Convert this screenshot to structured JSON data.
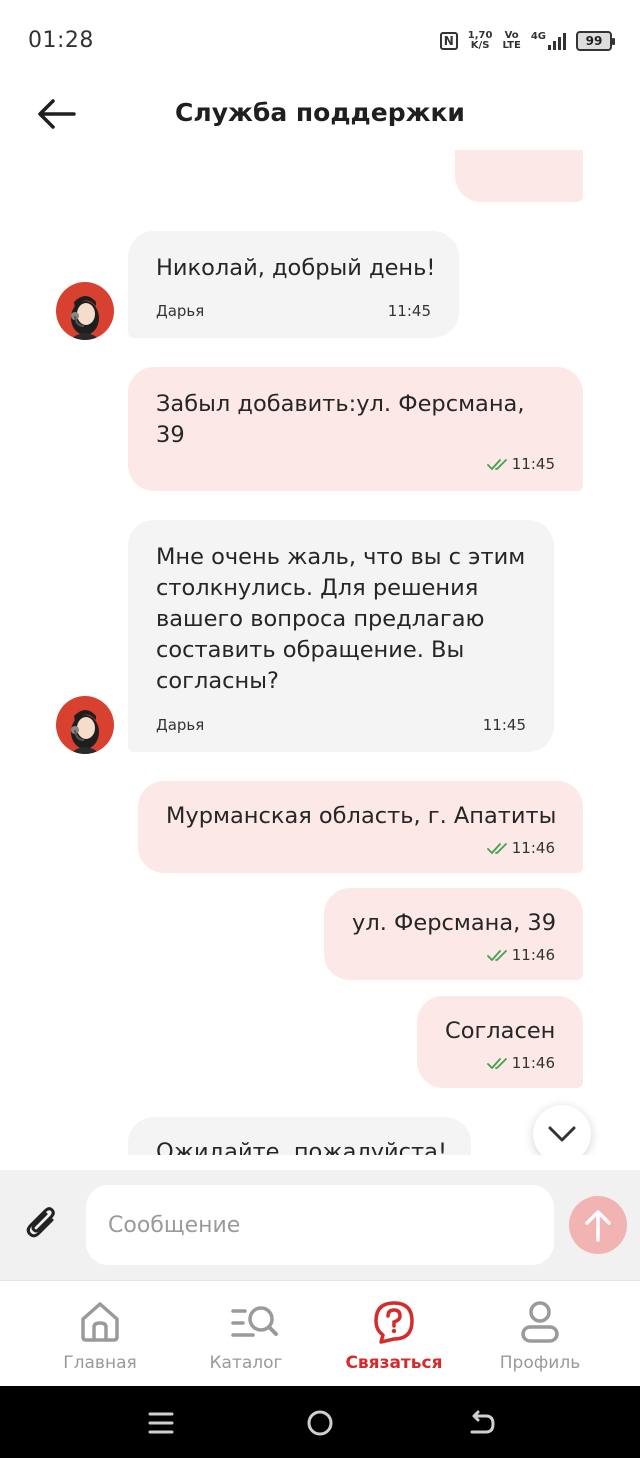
{
  "status_bar": {
    "time": "01:28",
    "net_speed_top": "1,70",
    "net_speed_bottom": "K/S",
    "volte_top": "Vo",
    "volte_bottom": "LTE",
    "network": "4G",
    "battery": "99"
  },
  "header": {
    "title": "Служба поддержки"
  },
  "messages": [
    {
      "direction": "in",
      "text": "Николай, добрый день!",
      "sender": "Дарья",
      "time": "11:45"
    },
    {
      "direction": "out",
      "text_line1": "Забыл добавить:ул. Ферсмана,",
      "text_line2": "39",
      "time": "11:45",
      "status": "read"
    },
    {
      "direction": "in",
      "lines": [
        "Мне очень жаль, что вы с этим",
        "столкнулись. Для решения",
        "вашего вопроса предлагаю",
        "составить обращение. Вы",
        "согласны?"
      ],
      "sender": "Дарья",
      "time": "11:45"
    },
    {
      "direction": "out",
      "text": "Мурманская область, г. Апатиты",
      "time": "11:46",
      "status": "read"
    },
    {
      "direction": "out",
      "text": "ул. Ферсмана, 39",
      "time": "11:46",
      "status": "read"
    },
    {
      "direction": "out",
      "text": "Согласен",
      "time": "11:46",
      "status": "read"
    },
    {
      "direction": "in",
      "text": "Ожидайте, пожалуйста!"
    }
  ],
  "composer": {
    "placeholder": "Сообщение",
    "value": ""
  },
  "bottom_nav": [
    {
      "label": "Главная",
      "icon": "home-icon",
      "active": false
    },
    {
      "label": "Каталог",
      "icon": "catalog-search-icon",
      "active": false
    },
    {
      "label": "Связаться",
      "icon": "help-chat-icon",
      "active": true
    },
    {
      "label": "Профиль",
      "icon": "profile-icon",
      "active": false
    }
  ],
  "colors": {
    "accent": "#d52b2b",
    "outgoing_bubble": "#fde8e8",
    "incoming_bubble": "#f4f4f4",
    "read_tick": "#3fa34d",
    "send_button": "#f2b3b3"
  }
}
